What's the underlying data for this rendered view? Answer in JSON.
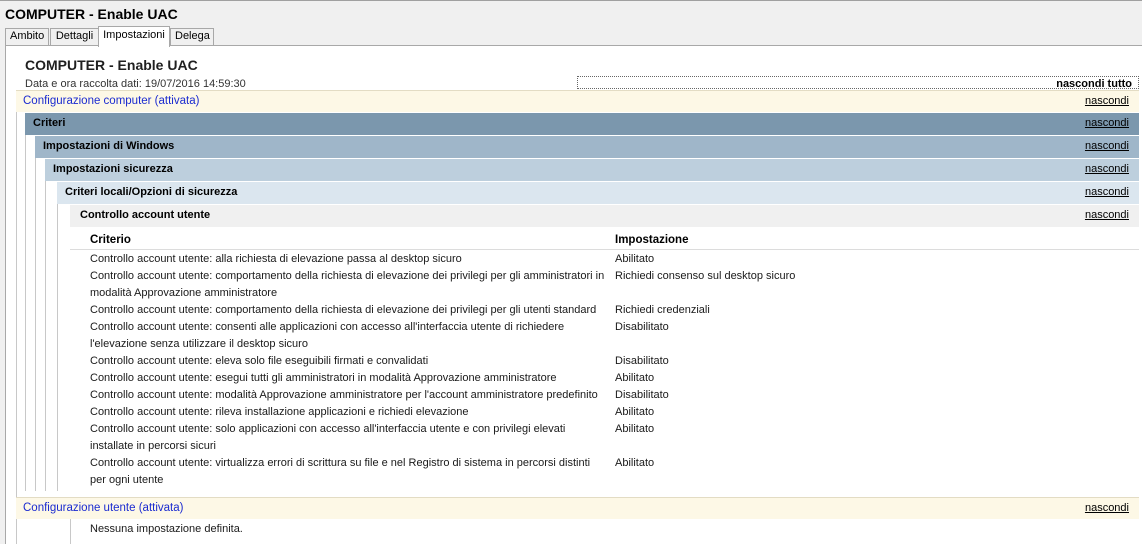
{
  "window": {
    "title": "COMPUTER - Enable UAC"
  },
  "tabs": [
    {
      "label": "Ambito"
    },
    {
      "label": "Dettagli"
    },
    {
      "label": "Impostazioni"
    },
    {
      "label": "Delega"
    }
  ],
  "report": {
    "title": "COMPUTER - Enable UAC",
    "date_line": "Data e ora raccolta dati: 19/07/2016 14:59:30",
    "hide_all": "nascondi tutto"
  },
  "sections": {
    "hide_link": "nascondi",
    "computer": "Configurazione computer (attivata)",
    "criteri": "Criteri",
    "windows": "Impostazioni di Windows",
    "security": "Impostazioni sicurezza",
    "local": "Criteri locali/Opzioni di sicurezza",
    "uac": "Controllo account utente",
    "user": "Configurazione utente (attivata)",
    "user_empty": "Nessuna impostazione definita."
  },
  "table": {
    "headers": [
      "Criterio",
      "Impostazione"
    ],
    "rows": [
      {
        "policy": "Controllo account utente: alla richiesta di elevazione passa al desktop sicuro",
        "setting": "Abilitato"
      },
      {
        "policy": "Controllo account utente: comportamento della richiesta di elevazione dei privilegi per gli amministratori in modalità Approvazione amministratore",
        "setting": "Richiedi consenso sul desktop sicuro"
      },
      {
        "policy": "Controllo account utente: comportamento della richiesta di elevazione dei privilegi per gli utenti standard",
        "setting": "Richiedi credenziali"
      },
      {
        "policy": "Controllo account utente: consenti alle applicazioni con accesso all'interfaccia utente di richiedere l'elevazione senza utilizzare il desktop sicuro",
        "setting": "Disabilitato"
      },
      {
        "policy": "Controllo account utente: eleva solo file eseguibili firmati e convalidati",
        "setting": "Disabilitato"
      },
      {
        "policy": "Controllo account utente: esegui tutti gli amministratori in modalità Approvazione amministratore",
        "setting": "Abilitato"
      },
      {
        "policy": "Controllo account utente: modalità Approvazione amministratore per l'account amministratore predefinito",
        "setting": "Disabilitato"
      },
      {
        "policy": "Controllo account utente: rileva installazione applicazioni e richiedi elevazione",
        "setting": "Abilitato"
      },
      {
        "policy": "Controllo account utente: solo applicazioni con accesso all'interfaccia utente e con privilegi elevati installate in percorsi sicuri",
        "setting": "Abilitato"
      },
      {
        "policy": "Controllo account utente: virtualizza errori di scrittura su file e nel Registro di sistema in percorsi distinti per ogni utente",
        "setting": "Abilitato"
      }
    ]
  }
}
